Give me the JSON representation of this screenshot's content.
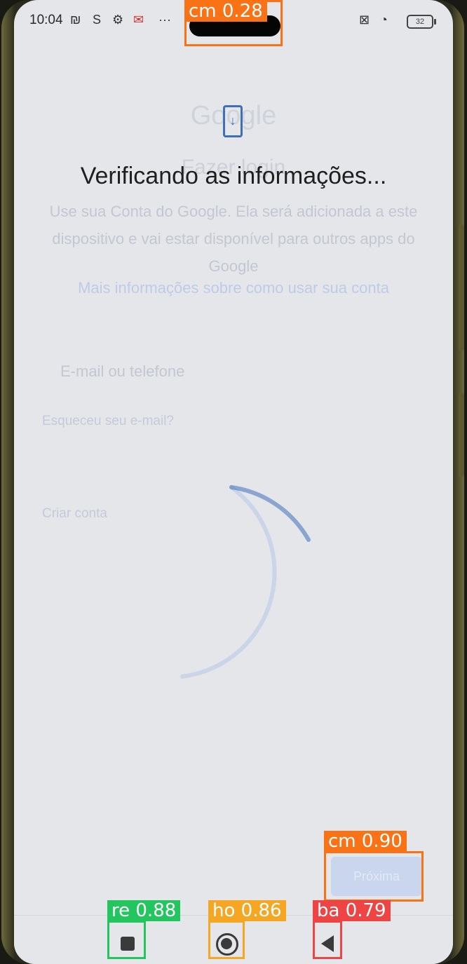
{
  "status_bar": {
    "time": "10:04",
    "battery": "32"
  },
  "background_form": {
    "logo": "Google",
    "title": "Fazer login",
    "description": "Use sua Conta do Google. Ela será adicionada a este dispositivo e vai estar disponível para outros apps do Google",
    "link": "Mais informações sobre como usar sua conta",
    "email_placeholder": "E-mail ou telefone",
    "forgot_email": "Esqueceu seu e-mail?",
    "create_account": "Criar conta"
  },
  "overlay": {
    "title": "Verificando as informações...",
    "icon": "phone-download-icon"
  },
  "next_button": {
    "label": "Próxima"
  },
  "navbar": {
    "recent_icon": "square-icon",
    "home_icon": "circle-icon",
    "back_icon": "triangle-back-icon"
  },
  "detections": [
    {
      "label": "cm",
      "score": "0.28",
      "color": "#f97316"
    },
    {
      "label": "cm",
      "score": "0.90",
      "color": "#f97316"
    },
    {
      "label": "re",
      "score": "0.88",
      "color": "#22c55e"
    },
    {
      "label": "ho",
      "score": "0.86",
      "color": "#f5a623"
    },
    {
      "label": "ba",
      "score": "0.79",
      "color": "#ef4444"
    }
  ]
}
